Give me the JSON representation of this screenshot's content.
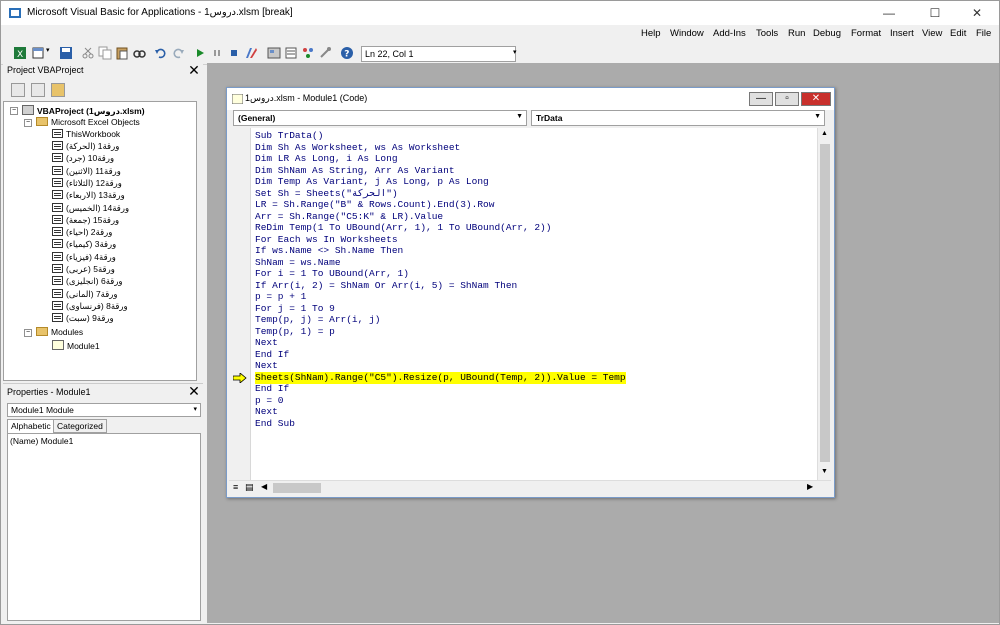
{
  "window": {
    "title": "Microsoft Visual Basic for Applications - دروس1.xlsm [break]",
    "minimize": "—",
    "maximize": "☐",
    "close": "✕"
  },
  "menu": [
    "Help",
    "Window",
    "Add-Ins",
    "Tools",
    "Run",
    "Debug",
    "Format",
    "Insert",
    "View",
    "Edit",
    "File"
  ],
  "toolbar": {
    "position": "Ln 22, Col 1",
    "icons": [
      "excel-icon",
      "insert-module-icon",
      "save-icon",
      "cut-icon",
      "copy-icon",
      "paste-icon",
      "find-icon",
      "undo-icon",
      "redo-icon",
      "run-icon",
      "break-icon",
      "reset-icon",
      "design-mode-icon",
      "project-explorer-icon",
      "properties-icon",
      "object-browser-icon",
      "toolbox-icon",
      "help-icon"
    ]
  },
  "project_pane": {
    "header": "Project   VBAProject",
    "root": "VBAProject (دروس1.xlsm)",
    "folder_objects": "Microsoft Excel Objects",
    "this_workbook": "ThisWorkbook",
    "sheets": [
      "ورقة1 (الحركة)",
      "ورقة10 (جرد)",
      "ورقة11 (الاثنين)",
      "ورقة12 (الثلاثاء)",
      "ورقة13 (الاربعاء)",
      "ورقة14 (الخميس)",
      "ورقة15 (جمعة)",
      "ورقة2 (احياء)",
      "ورقة3 (كيمياء)",
      "ورقة4 (فيزياء)",
      "ورقة5 (عربى)",
      "ورقة6 (انجليزى)",
      "ورقة7 (المانى)",
      "ورقة8 (فرنساوى)",
      "ورقة9 (سبت)"
    ],
    "folder_modules": "Modules",
    "module": "Module1"
  },
  "properties_pane": {
    "header": "Properties - Module1",
    "selected_object": "Module1 Module",
    "tab_alphabetic": "Alphabetic",
    "tab_categorized": "Categorized",
    "row": "(Name) Module1"
  },
  "code_window": {
    "title": "دروس1.xlsm - Module1 (Code)",
    "object_combo": "(General)",
    "proc_combo": "TrData",
    "lines": [
      "Sub TrData()",
      "Dim Sh As Worksheet, ws As Worksheet",
      "Dim LR As Long, i As Long",
      "Dim ShNam As String, Arr As Variant",
      "Dim Temp As Variant, j As Long, p As Long",
      "Set Sh = Sheets(\"الحركة\")",
      "LR = Sh.Range(\"B\" & Rows.Count).End(3).Row",
      "Arr = Sh.Range(\"C5:K\" & LR).Value",
      "ReDim Temp(1 To UBound(Arr, 1), 1 To UBound(Arr, 2))",
      "For Each ws In Worksheets",
      "If ws.Name <> Sh.Name Then",
      "ShNam = ws.Name",
      "For i = 1 To UBound(Arr, 1)",
      "If Arr(i, 2) = ShNam Or Arr(i, 5) = ShNam Then",
      "p = p + 1",
      "For j = 1 To 9",
      "Temp(p, j) = Arr(i, j)",
      "Temp(p, 1) = p",
      "Next",
      "End If",
      "Next",
      "Sheets(ShNam).Range(\"C5\").Resize(p, UBound(Temp, 2)).Value = Temp",
      "End If",
      "p = 0",
      "Next",
      "End Sub"
    ],
    "current_line_index": 21
  },
  "colors": {
    "highlight": "#ffff00",
    "code_text": "#00007b",
    "mdi_background": "#ababab"
  }
}
